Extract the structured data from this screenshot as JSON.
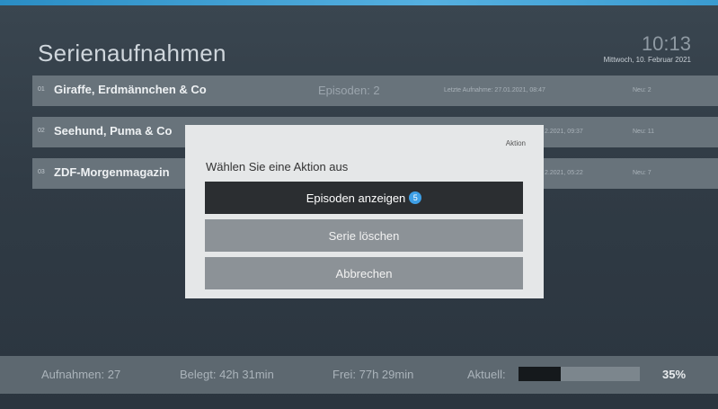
{
  "header": {
    "title": "Serienaufnahmen",
    "time": "10:13",
    "date": "Mittwoch, 10. Februar 2021"
  },
  "recordings": [
    {
      "num": "01",
      "title": "Giraffe, Erdmännchen & Co",
      "episodes": "Episoden: 2",
      "last": "Letzte Aufnahme: 27.01.2021, 08:47",
      "new": "Neu: 2"
    },
    {
      "num": "02",
      "title": "Seehund, Puma & Co",
      "episodes": "",
      "last": "2.2021, 09:37",
      "new": "Neu: 11"
    },
    {
      "num": "03",
      "title": "ZDF-Morgenmagazin",
      "episodes": "",
      "last": "2.2021, 05:22",
      "new": "Neu: 7"
    }
  ],
  "dialog": {
    "header": "Aktion",
    "prompt": "Wählen Sie eine Aktion aus",
    "buttons": {
      "show_episodes": "Episoden anzeigen",
      "show_episodes_badge": "5",
      "delete_series": "Serie löschen",
      "cancel": "Abbrechen"
    }
  },
  "storage": {
    "recordings": "Aufnahmen: 27",
    "used": "Belegt: 42h 31min",
    "free": "Frei: 77h 29min",
    "current_label": "Aktuell:",
    "current_fraction": 0.35,
    "current_percent": "35%"
  },
  "colors": {
    "badge": "#3e9fe6",
    "accent_strip": "#3a9bd0"
  }
}
